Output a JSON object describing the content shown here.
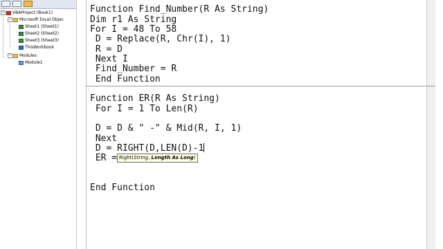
{
  "project_tree": {
    "root": "VBAProject (Book1)",
    "excel_objects_folder": "Microsoft Excel Objec",
    "sheets": [
      "Sheet1 (Sheet1)",
      "Sheet2 (Sheet2)",
      "Sheet3 (Sheet3)"
    ],
    "workbook": "ThisWorkbook",
    "modules_folder": "Modules",
    "modules": [
      "Module1"
    ]
  },
  "toolbar": {
    "buttons": [
      "view-code-icon",
      "view-object-icon",
      "toggle-folders-icon"
    ]
  },
  "code": {
    "block1": [
      "Function Find_Number(R As String)",
      "Dim r1 As String",
      "For I = 48 To 58",
      " D = Replace(R, Chr(I), 1)",
      " R = D",
      " Next I",
      " Find_Number = R",
      " End Function"
    ],
    "block2": [
      "Function ER(R As String)",
      " For I = 1 To Len(R)",
      "",
      " D = D & \" -\" & Mid(R, I, 1)",
      " Next",
      " D = RIGHT(D,LEN(D)-1",
      " ER = ",
      "",
      "",
      "End Function"
    ]
  },
  "tooltip": {
    "func": "Right(",
    "arg1": "String",
    "sep": ", ",
    "arg2_bold": "Length As Long",
    "close": ")"
  },
  "colors": {
    "toolbar_bg": "#dfe6ef",
    "tooltip_bg": "#ffffe1",
    "folder": "#f3b84a"
  }
}
